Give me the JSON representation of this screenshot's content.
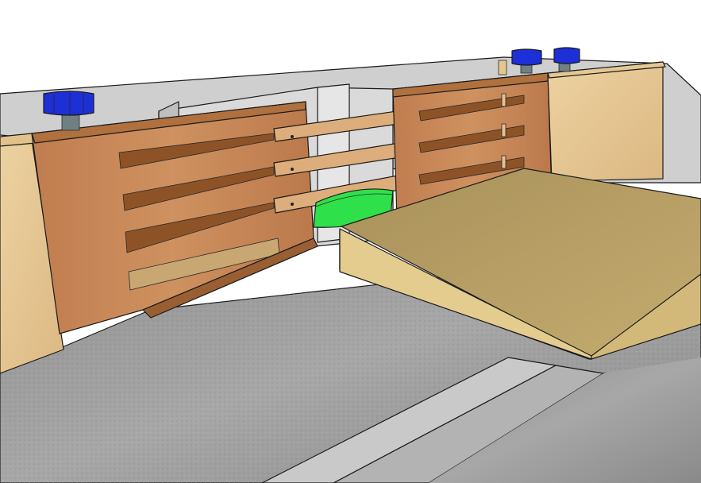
{
  "scene": {
    "subject": "router-table-fence-with-sliding-guard",
    "colors": {
      "background": "#ffffff",
      "table_top": "#9a9a9a",
      "table_edge": "#c8c8c8",
      "fence_wall": "#d6d6d6",
      "fence_wood": "#c8875a",
      "fence_wood_dark": "#a86a40",
      "guard_slat": "#dcae7c",
      "maple_block": "#e7c793",
      "workpiece_top": "#b89e62",
      "workpiece_side": "#dcc487",
      "router_bit": "#2ee04a",
      "knob": "#1d2fd6",
      "knob_stem": "#6f7f82"
    },
    "icons": [
      "knob-icon",
      "router-bit-icon"
    ]
  }
}
